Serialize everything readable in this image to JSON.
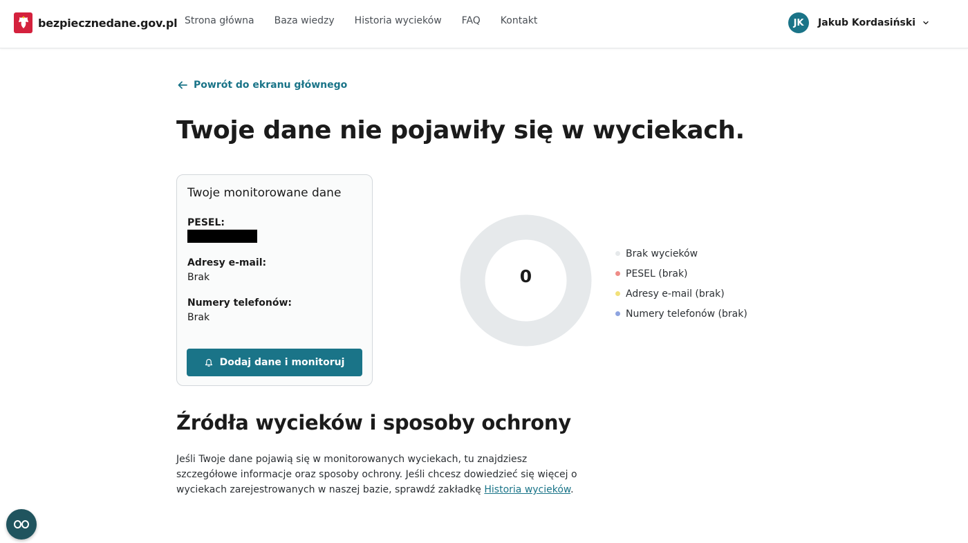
{
  "header": {
    "site_name": "bezpiecznedane.gov.pl",
    "nav": [
      {
        "label": "Strona główna"
      },
      {
        "label": "Baza wiedzy"
      },
      {
        "label": "Historia wycieków"
      },
      {
        "label": "FAQ"
      },
      {
        "label": "Kontakt"
      }
    ],
    "user": {
      "initials": "JK",
      "name": "Jakub Kordasiński"
    }
  },
  "back_link": "Powrót do ekranu głównego",
  "page_title": "Twoje dane nie pojawiły się w wyciekach.",
  "monitored_card": {
    "title": "Twoje monitorowane dane",
    "fields": [
      {
        "label": "PESEL:",
        "value": ""
      },
      {
        "label": "Adresy e-mail:",
        "value": "Brak"
      },
      {
        "label": "Numery telefonów:",
        "value": "Brak"
      }
    ],
    "button_label": "Dodaj dane i monitoruj"
  },
  "summary_chart": {
    "center_value": "0",
    "legend": [
      {
        "label": "Brak wycieków",
        "color": "#e6e9eb"
      },
      {
        "label": "PESEL (brak)",
        "color": "#ef8c87"
      },
      {
        "label": "Adresy e-mail (brak)",
        "color": "#f2e17a"
      },
      {
        "label": "Numery telefonów (brak)",
        "color": "#8ea4e0"
      }
    ]
  },
  "sources_section": {
    "title": "Źródła wycieków i sposoby ochrony",
    "text_before_link": "Jeśli Twoje dane pojawią się w monitorowanych wyciekach, tu znajdziesz szczegółowe informacje oraz sposoby ochrony. Jeśli chcesz dowiedzieć się więcej o wyciekach zarejestrowanych w naszej bazie, sprawdź zakładkę ",
    "link_text": "Historia wycieków",
    "text_after_link": "."
  },
  "colors": {
    "accent": "#1a7488",
    "brand_red": "#d4213d",
    "donut_ring": "#e6e9eb"
  }
}
